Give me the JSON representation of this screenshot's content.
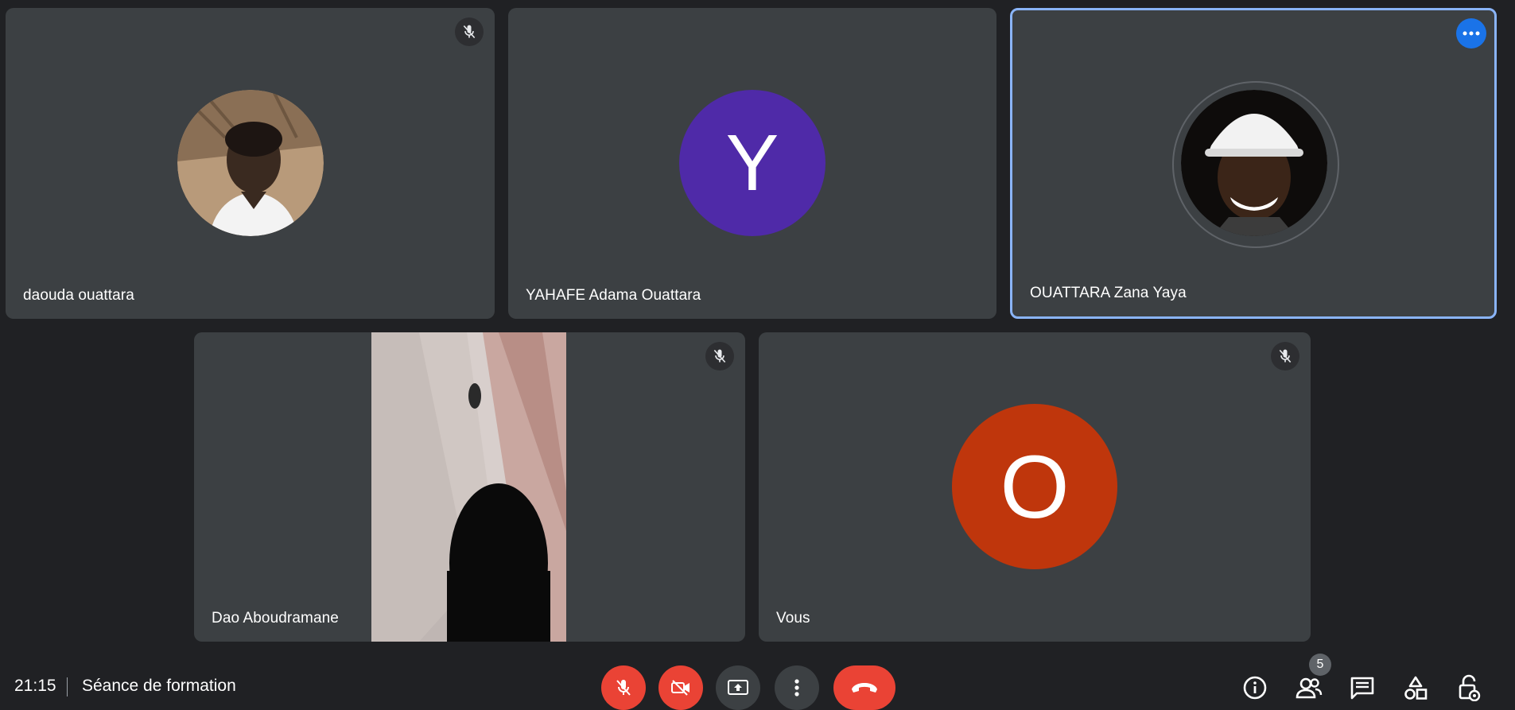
{
  "participants": [
    {
      "name": "daouda ouattara",
      "muted": true,
      "avatar_type": "photo"
    },
    {
      "name": "YAHAFE Adama Ouattara",
      "avatar_letter": "Y",
      "avatar_color": "#4f2aa8"
    },
    {
      "name": "OUATTARA Zana Yaya",
      "avatar_type": "photo",
      "active_speaker": true
    },
    {
      "name": "Dao Aboudramane",
      "muted": true,
      "avatar_type": "video"
    },
    {
      "name": "Vous",
      "muted": true,
      "avatar_letter": "O",
      "avatar_color": "#bf360c"
    }
  ],
  "meeting": {
    "time": "21:15",
    "title": "Séance de formation"
  },
  "controls": {
    "mic": "mic-off-icon",
    "camera": "videocam-off-icon",
    "present": "present-screen-icon",
    "more": "more-vert-icon",
    "end_call": "call-end-icon"
  },
  "right_panel": {
    "participants_count": "5",
    "icons": [
      "info-icon",
      "people-icon",
      "chat-icon",
      "activities-icon",
      "host-controls-icon"
    ]
  },
  "colors": {
    "background": "#202124",
    "tile": "#3c4043",
    "active_border": "#8ab4f8",
    "danger": "#ea4335",
    "accent": "#1a73e8"
  }
}
